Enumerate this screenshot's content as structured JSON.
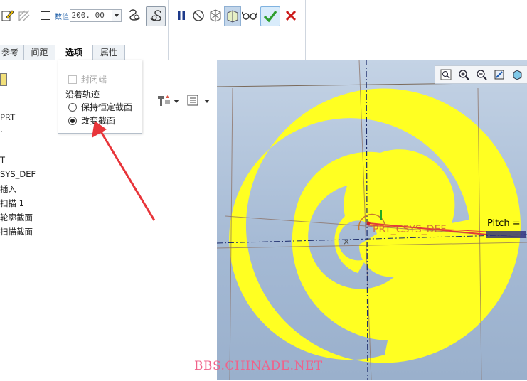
{
  "toolbar": {
    "value_label": "数值",
    "value": "200. 00",
    "icons": [
      "pencil-icon",
      "hatch-icon",
      "rectangle-icon",
      "value-label-icon",
      "dropdown-arrow-icon",
      "helix-left-icon",
      "helix-right-icon",
      "pause-icon",
      "no-icon",
      "preview-icon",
      "preview-verify-icon",
      "glasses-icon",
      "confirm-check-icon",
      "cancel-x-icon"
    ],
    "colors": {
      "confirm": "#2e9e2e",
      "cancel": "#cc1a1a",
      "confirm_bg": "#d9ecfb"
    }
  },
  "tabs": [
    {
      "label": "参考"
    },
    {
      "label": "间距"
    },
    {
      "label": "选项",
      "active": true
    },
    {
      "label": "属性"
    }
  ],
  "popup": {
    "closed_end_label": "封闭端",
    "along_trajectory_label": "沿着轨迹",
    "options": [
      {
        "label": "保持恒定截面",
        "selected": false
      },
      {
        "label": "改变截面",
        "selected": true
      }
    ]
  },
  "tree": {
    "items": [
      "PRT",
      "·",
      "T",
      "SYS_DEF",
      "插入",
      "扫描 1",
      "轮廓截面",
      "扫描截面"
    ]
  },
  "viewport": {
    "csys_label": "PRT_CSYS_DEF",
    "pitch_label": "Pitch =",
    "colors": {
      "spiral": "#ffff22",
      "background_top": "#c4d3e5",
      "background_bottom": "#9ab0cc"
    }
  },
  "watermark": "BBS.CHINADE.NET"
}
